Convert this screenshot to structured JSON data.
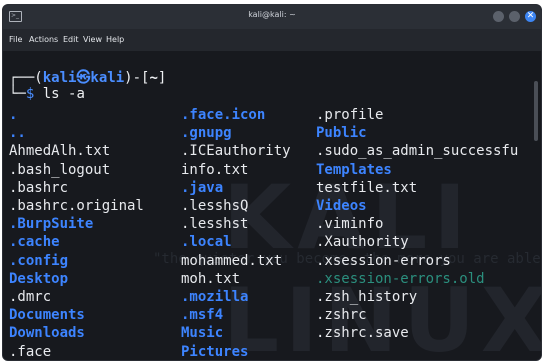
{
  "window": {
    "title": "kali@kali: ~",
    "icon": "terminal-icon",
    "buttons": [
      "minimize",
      "maximize",
      "close"
    ],
    "close_glyph": "✕"
  },
  "menu": [
    "File",
    "Actions",
    "Edit",
    "View",
    "Help"
  ],
  "prompt": {
    "corner": "┌──(",
    "user_host": "kali㉿kali",
    "mid": ")-[",
    "path": "~",
    "end": "]",
    "second_prefix": "└─",
    "dollar": "$",
    "command": "ls -a"
  },
  "watermark": "KALI LINUX",
  "watermark_tagline": "\"the quieter you become, the more you are able to hear\"",
  "colors": {
    "file": "#e8eaee",
    "directory": "#3d84ff",
    "faded_file": "#2b8f7e",
    "background": "#17191e"
  },
  "listing": {
    "columns": [
      [
        {
          "name": ".",
          "type": "dir"
        },
        {
          "name": "..",
          "type": "dir"
        },
        {
          "name": "AhmedAlh.txt",
          "type": "file"
        },
        {
          "name": ".bash_logout",
          "type": "file"
        },
        {
          "name": ".bashrc",
          "type": "file"
        },
        {
          "name": ".bashrc.original",
          "type": "file"
        },
        {
          "name": ".BurpSuite",
          "type": "dir"
        },
        {
          "name": ".cache",
          "type": "dir"
        },
        {
          "name": ".config",
          "type": "dir"
        },
        {
          "name": "Desktop",
          "type": "dir"
        },
        {
          "name": ".dmrc",
          "type": "file"
        },
        {
          "name": "Documents",
          "type": "dir"
        },
        {
          "name": "Downloads",
          "type": "dir"
        },
        {
          "name": ".face",
          "type": "file"
        }
      ],
      [
        {
          "name": ".face.icon",
          "type": "dir"
        },
        {
          "name": ".gnupg",
          "type": "dir"
        },
        {
          "name": ".ICEauthority",
          "type": "file"
        },
        {
          "name": "info.txt",
          "type": "file"
        },
        {
          "name": ".java",
          "type": "dir"
        },
        {
          "name": ".lesshsQ",
          "type": "file"
        },
        {
          "name": ".lesshst",
          "type": "file"
        },
        {
          "name": ".local",
          "type": "dir"
        },
        {
          "name": "mohammed.txt",
          "type": "file"
        },
        {
          "name": "moh.txt",
          "type": "file"
        },
        {
          "name": ".mozilla",
          "type": "dir"
        },
        {
          "name": ".msf4",
          "type": "dir"
        },
        {
          "name": "Music",
          "type": "dir"
        },
        {
          "name": "Pictures",
          "type": "dir"
        }
      ],
      [
        {
          "name": ".profile",
          "type": "file"
        },
        {
          "name": "Public",
          "type": "dir"
        },
        {
          "name": ".sudo_as_admin_successfu",
          "type": "file"
        },
        {
          "name": "Templates",
          "type": "dir"
        },
        {
          "name": "testfile.txt",
          "type": "file"
        },
        {
          "name": "Videos",
          "type": "dir"
        },
        {
          "name": ".viminfo",
          "type": "file"
        },
        {
          "name": ".Xauthority",
          "type": "file"
        },
        {
          "name": ".xsession-errors",
          "type": "file"
        },
        {
          "name": ".xsession-errors.old",
          "type": "dim"
        },
        {
          "name": ".zsh_history",
          "type": "file"
        },
        {
          "name": ".zshrc",
          "type": "file"
        },
        {
          "name": ".zshrc.save",
          "type": "file"
        }
      ]
    ]
  }
}
